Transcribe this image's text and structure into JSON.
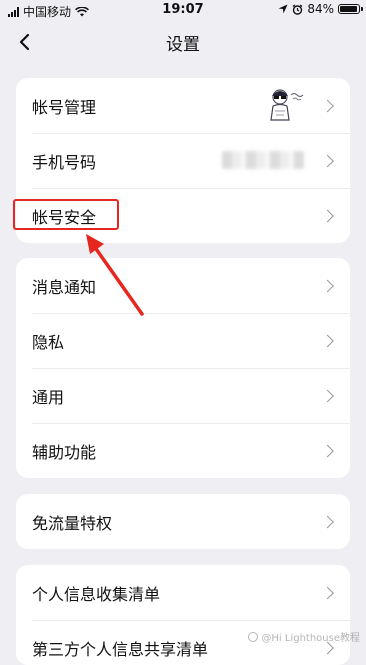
{
  "status_bar": {
    "carrier": "中国移动",
    "time": "19:07",
    "battery": "84%",
    "battery_level": 0.84
  },
  "nav": {
    "title": "设置",
    "back_icon": "chevron-left-icon"
  },
  "groups": [
    {
      "items": [
        {
          "label": "帐号管理",
          "accessory": "avatar"
        },
        {
          "label": "手机号码",
          "accessory": "blurred-phone"
        },
        {
          "label": "帐号安全"
        }
      ]
    },
    {
      "items": [
        {
          "label": "消息通知"
        },
        {
          "label": "隐私"
        },
        {
          "label": "通用"
        },
        {
          "label": "辅助功能"
        }
      ]
    },
    {
      "items": [
        {
          "label": "免流量特权"
        }
      ]
    },
    {
      "items": [
        {
          "label": "个人信息收集清单"
        },
        {
          "label": "第三方个人信息共享清单"
        }
      ]
    }
  ],
  "annotation": {
    "highlight_color": "#e5271f"
  },
  "watermark": {
    "text": "@Hi Lighthouse教程"
  }
}
